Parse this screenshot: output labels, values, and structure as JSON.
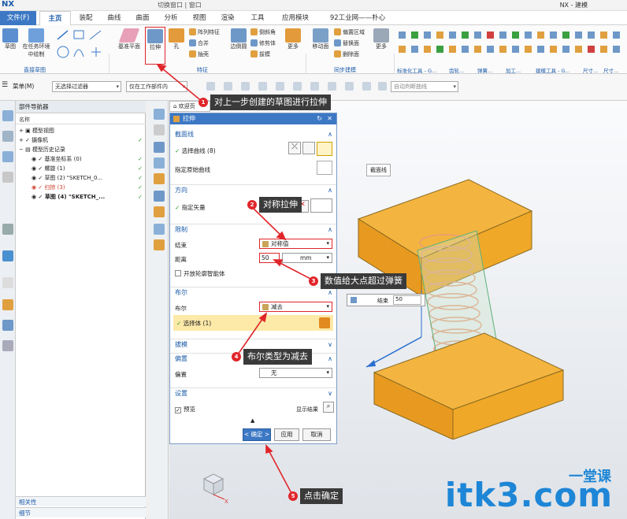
{
  "titlebar": {
    "logo": "NX",
    "title": "NX - 建模",
    "quick": "切换窗口 | 窗口"
  },
  "menu": {
    "tabs": [
      "文件(F)",
      "主页",
      "装配",
      "曲线",
      "曲面",
      "分析",
      "视图",
      "渲染",
      "工具",
      "应用模块",
      "92工业网——朴心"
    ]
  },
  "ribbon": {
    "big": [
      {
        "label": "草图"
      },
      {
        "label": "在任务环境中绘制"
      },
      {
        "label": "基准平面"
      },
      {
        "label": "拉伸"
      },
      {
        "label": "孔"
      },
      {
        "label": "边倒圆"
      },
      {
        "label": "更多"
      },
      {
        "label": "移动面"
      },
      {
        "label": "更多"
      }
    ],
    "small": [
      "阵列特征",
      "合并",
      "抽壳",
      "倒斜角",
      "修剪体",
      "拔模",
      "偏置区域",
      "替换面",
      "删除面"
    ],
    "groups": [
      "直接草图",
      "特征",
      "同步建模",
      "标准化工具 - G...",
      "齿轮...",
      "弹簧...",
      "加工...",
      "建模工具 - G...",
      "尺寸...",
      "尺寸..."
    ]
  },
  "toolbar2": {
    "menu_label": "菜单(M)",
    "filter": "无选择过滤器",
    "scope": "仅在工作部件内",
    "search_placeholder": "自动判断曲线"
  },
  "navigator": {
    "title": "部件导航器",
    "col_name": "名称",
    "rows": [
      {
        "label": "模型视图",
        "indent": 1,
        "check": false
      },
      {
        "label": "摄像机",
        "indent": 1,
        "check": true
      },
      {
        "label": "模型历史记录",
        "indent": 1,
        "check": false
      },
      {
        "label": "基准坐标系 (0)",
        "indent": 2,
        "check": true
      },
      {
        "label": "螺旋 (1)",
        "indent": 2,
        "check": true
      },
      {
        "label": "草图 (2) \"SKETCH_0...",
        "indent": 2,
        "check": true
      },
      {
        "label": "扫掠 (3)",
        "indent": 2,
        "check": true
      },
      {
        "label": "草图 (4) \"SKETCH_...",
        "indent": 2,
        "check": true
      }
    ],
    "foot1": "相关性",
    "foot2": "细节"
  },
  "tab": {
    "label": "欢迎页"
  },
  "dialog": {
    "title": "拉伸",
    "sec_profile": "截面线",
    "select_curve": "选择曲线 (8)",
    "specify_origin": "指定原始曲线",
    "sec_direction": "方向",
    "specify_vector": "指定矢量",
    "sec_limits": "限制",
    "end_label": "结束",
    "end_value": "对称值",
    "dist_label": "距离",
    "dist_value": "50",
    "dist_unit": "mm",
    "open_profile": "开放轮廓智能体",
    "sec_boolean": "布尔",
    "bool_label": "布尔",
    "bool_value": "减去",
    "select_body": "选择体 (1)",
    "sec_draft": "拔模",
    "sec_offset": "偏置",
    "offset_label": "偏置",
    "offset_value": "无",
    "sec_settings": "设置",
    "preview": "预览",
    "show_result": "显示结果",
    "ok": "< 确定 >",
    "apply": "应用",
    "cancel": "取消"
  },
  "viewport": {
    "label_profile": "截面线",
    "end_label": "结束",
    "end_value": "50"
  },
  "callouts": [
    {
      "num": "1",
      "text": "对上一步创建的草图进行拉伸"
    },
    {
      "num": "2",
      "text": "对称拉伸"
    },
    {
      "num": "3",
      "text": "数值给大点超过弹簧"
    },
    {
      "num": "4",
      "text": "布尔类型为减去"
    },
    {
      "num": "5",
      "text": "点击确定"
    }
  ],
  "watermark": {
    "main": "itk3.com",
    "sub": "一堂课"
  },
  "colors": {
    "accent": "#3c78c4",
    "block": "#f0a826",
    "spring": "#e8a07a",
    "callout_num": "#e0262b"
  }
}
